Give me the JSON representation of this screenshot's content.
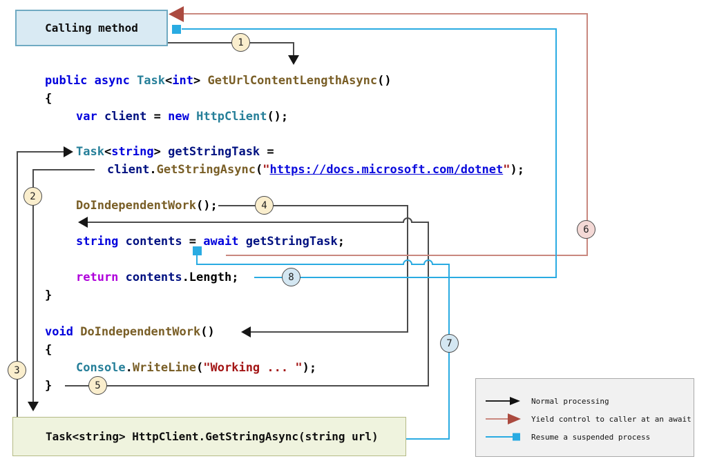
{
  "colors": {
    "kw": "#0101dd",
    "type": "#267f99",
    "fn": "#795e26",
    "var": "#001080",
    "str": "#a31515",
    "ctrl": "#af00db",
    "url": "#0b0bdd",
    "plain": "#000000",
    "wire_black": "#4a4a4a",
    "wire_red": "#c9877e",
    "wire_red_head": "#ab4a3f",
    "wire_cyan": "#29abe2",
    "box_call_bg": "#d9eaf3",
    "box_call_border": "#70aac2",
    "box_task_bg": "#eff3de",
    "box_task_border": "#b4ba85",
    "circle_cream": "#faeecd",
    "circle_pink": "#f4d9d6",
    "circle_blue": "#d4e7f2",
    "legend_bg": "#f1f1f1",
    "legend_border": "#a9a9a9"
  },
  "boxes": {
    "calling": {
      "label": "Calling method"
    },
    "task": {
      "label": "Task<string> HttpClient.GetStringAsync(string url)"
    }
  },
  "code": {
    "lines": [
      {
        "tokens": [
          [
            "public async ",
            "kw"
          ],
          [
            "Task",
            "type"
          ],
          [
            "<",
            "plain"
          ],
          [
            "int",
            "kw"
          ],
          [
            "> ",
            "plain"
          ],
          [
            "GetUrlContentLengthAsync",
            "fn"
          ],
          [
            "()",
            "plain"
          ]
        ]
      },
      {
        "tokens": [
          [
            "{",
            "plain"
          ]
        ]
      },
      {
        "tokens": [
          [
            "var",
            "kw"
          ],
          [
            " ",
            "plain"
          ],
          [
            "client",
            "var"
          ],
          [
            " = ",
            "plain"
          ],
          [
            "new",
            "kw"
          ],
          [
            " ",
            "plain"
          ],
          [
            "HttpClient",
            "type"
          ],
          [
            "();",
            "plain"
          ]
        ]
      },
      {
        "tokens": [
          [
            "Task",
            "type"
          ],
          [
            "<",
            "plain"
          ],
          [
            "string",
            "kw"
          ],
          [
            "> ",
            "plain"
          ],
          [
            "getStringTask",
            "var"
          ],
          [
            " =",
            "plain"
          ]
        ]
      },
      {
        "tokens": [
          [
            "client",
            "var"
          ],
          [
            ".",
            "plain"
          ],
          [
            "GetStringAsync",
            "fn"
          ],
          [
            "(",
            "plain"
          ],
          [
            "\"",
            "str"
          ],
          [
            "https://docs.microsoft.com/dotnet",
            "url"
          ],
          [
            "\"",
            "str"
          ],
          [
            ");",
            "plain"
          ]
        ]
      },
      {
        "tokens": [
          [
            "DoIndependentWork",
            "fn"
          ],
          [
            "();",
            "plain"
          ]
        ]
      },
      {
        "tokens": [
          [
            "string",
            "kw"
          ],
          [
            " ",
            "plain"
          ],
          [
            "contents",
            "var"
          ],
          [
            " = ",
            "plain"
          ],
          [
            "await",
            "kw"
          ],
          [
            " ",
            "plain"
          ],
          [
            "getStringTask",
            "var"
          ],
          [
            ";",
            "plain"
          ]
        ]
      },
      {
        "tokens": [
          [
            "return",
            "ctrl"
          ],
          [
            " ",
            "plain"
          ],
          [
            "contents",
            "var"
          ],
          [
            ".Length;",
            "plain"
          ]
        ]
      },
      {
        "tokens": [
          [
            "}",
            "plain"
          ]
        ]
      },
      {
        "tokens": [
          [
            "void",
            "kw"
          ],
          [
            " ",
            "plain"
          ],
          [
            "DoIndependentWork",
            "fn"
          ],
          [
            "()",
            "plain"
          ]
        ]
      },
      {
        "tokens": [
          [
            "{",
            "plain"
          ]
        ]
      },
      {
        "tokens": [
          [
            "Console",
            "type"
          ],
          [
            ".",
            "plain"
          ],
          [
            "WriteLine",
            "fn"
          ],
          [
            "(",
            "plain"
          ],
          [
            "\"Working ... \"",
            "str"
          ],
          [
            ");",
            "plain"
          ]
        ]
      },
      {
        "tokens": [
          [
            "}",
            "plain"
          ]
        ]
      }
    ]
  },
  "steps": [
    {
      "n": "1",
      "variant": "cream"
    },
    {
      "n": "2",
      "variant": "cream"
    },
    {
      "n": "3",
      "variant": "cream"
    },
    {
      "n": "4",
      "variant": "cream"
    },
    {
      "n": "5",
      "variant": "cream"
    },
    {
      "n": "6",
      "variant": "pink"
    },
    {
      "n": "7",
      "variant": "blue"
    },
    {
      "n": "8",
      "variant": "blue"
    }
  ],
  "legend": {
    "items": [
      {
        "type": "normal",
        "label": "Normal processing"
      },
      {
        "type": "yield",
        "label": "Yield control to caller at an await"
      },
      {
        "type": "resume",
        "label": "Resume a suspended process"
      }
    ]
  }
}
